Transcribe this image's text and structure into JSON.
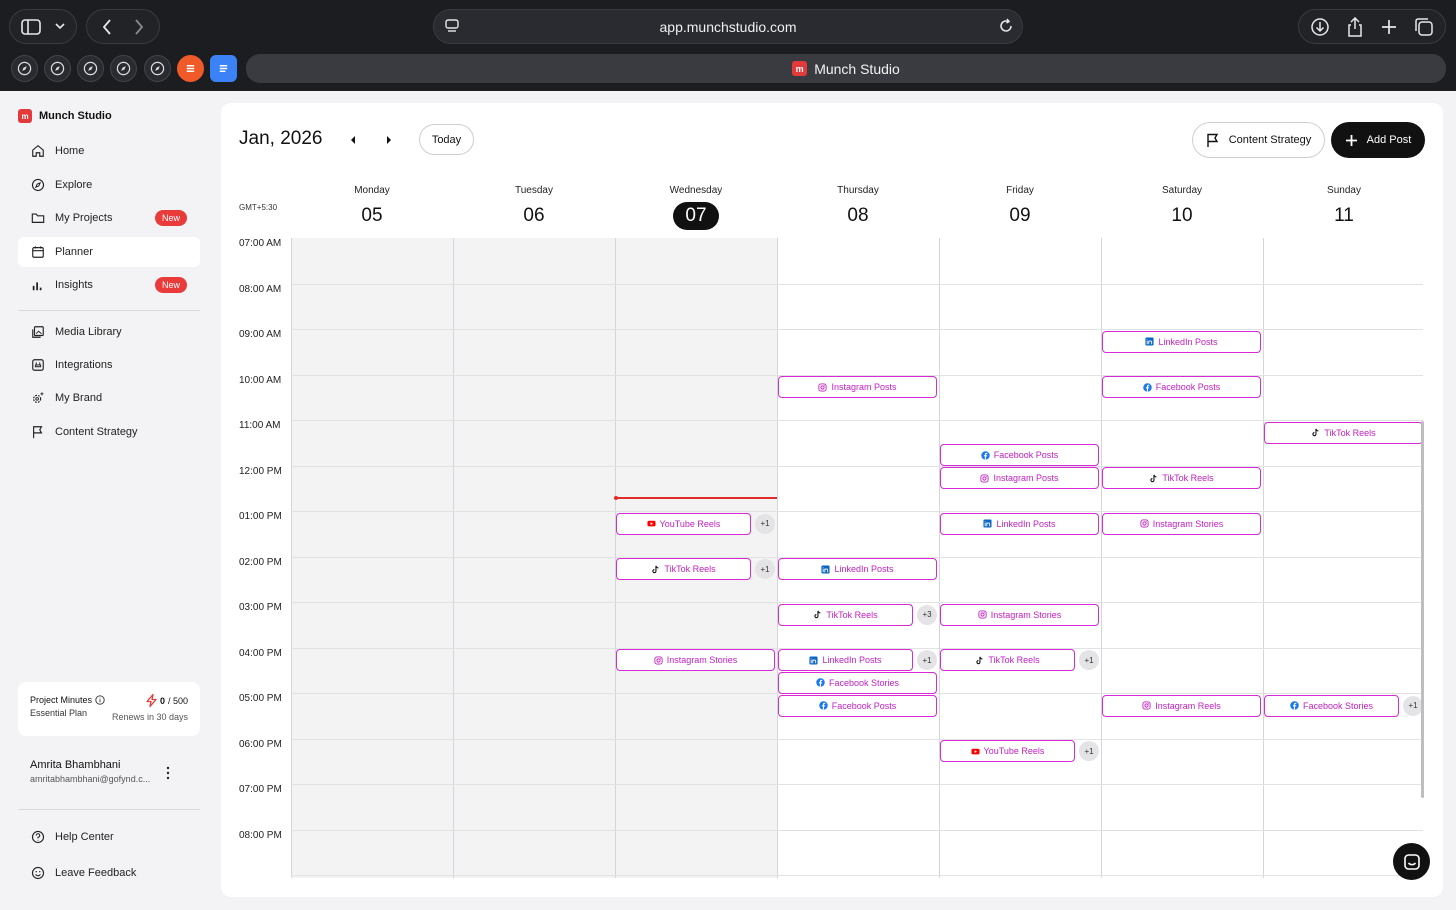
{
  "browser": {
    "url": "app.munchstudio.com",
    "tab_title": "Munch Studio"
  },
  "sidebar": {
    "brand": "Munch Studio",
    "items": [
      {
        "label": "Home",
        "icon": "home-icon"
      },
      {
        "label": "Explore",
        "icon": "compass-icon"
      },
      {
        "label": "My Projects",
        "icon": "folder-icon",
        "badge": "New"
      },
      {
        "label": "Planner",
        "icon": "calendar-icon",
        "active": true
      },
      {
        "label": "Insights",
        "icon": "bar-chart-icon",
        "badge": "New"
      },
      {
        "label": "Media Library",
        "icon": "media-icon"
      },
      {
        "label": "Integrations",
        "icon": "plug-icon"
      },
      {
        "label": "My Brand",
        "icon": "gear-sparkle-icon"
      },
      {
        "label": "Content Strategy",
        "icon": "flag-icon"
      }
    ],
    "minutes": {
      "title": "Project Minutes",
      "plan": "Essential Plan",
      "used": "0",
      "total": "/ 500",
      "renew": "Renews in 30 days"
    },
    "user": {
      "name": "Amrita Bhambhani",
      "email": "amritabhambhani@gofynd.c..."
    },
    "footer": [
      {
        "label": "Help Center",
        "icon": "help-icon"
      },
      {
        "label": "Leave Feedback",
        "icon": "smile-icon"
      }
    ]
  },
  "planner": {
    "month_label": "Jan, 2026",
    "today_label": "Today",
    "content_strategy_label": "Content Strategy",
    "add_post_label": "Add Post",
    "timezone": "GMT+5:30",
    "days": [
      {
        "name": "Monday",
        "num": "05"
      },
      {
        "name": "Tuesday",
        "num": "06"
      },
      {
        "name": "Wednesday",
        "num": "07",
        "current": true
      },
      {
        "name": "Thursday",
        "num": "08"
      },
      {
        "name": "Friday",
        "num": "09"
      },
      {
        "name": "Saturday",
        "num": "10"
      },
      {
        "name": "Sunday",
        "num": "11"
      }
    ],
    "time_labels": [
      "07:00 AM",
      "08:00 AM",
      "09:00 AM",
      "10:00 AM",
      "11:00 AM",
      "12:00 PM",
      "01:00 PM",
      "02:00 PM",
      "03:00 PM",
      "04:00 PM",
      "05:00 PM",
      "06:00 PM",
      "07:00 PM",
      "08:00 PM"
    ],
    "current_time_hour": 12.7,
    "events": [
      {
        "day": 2,
        "hour": 13,
        "label": "YouTube Reels",
        "icon": "youtube",
        "more": "+1"
      },
      {
        "day": 2,
        "hour": 14,
        "label": "TikTok Reels",
        "icon": "tiktok",
        "more": "+1"
      },
      {
        "day": 2,
        "hour": 16,
        "label": "Instagram Stories",
        "icon": "instagram"
      },
      {
        "day": 3,
        "hour": 10,
        "label": "Instagram Posts",
        "icon": "instagram"
      },
      {
        "day": 3,
        "hour": 14,
        "label": "LinkedIn Posts",
        "icon": "linkedin"
      },
      {
        "day": 3,
        "hour": 15,
        "label": "TikTok Reels",
        "icon": "tiktok",
        "more": "+3"
      },
      {
        "day": 3,
        "hour": 16,
        "label": "LinkedIn Posts",
        "icon": "linkedin",
        "more": "+1"
      },
      {
        "day": 3,
        "hour": 16.5,
        "label": "Facebook Stories",
        "icon": "facebook"
      },
      {
        "day": 3,
        "hour": 17,
        "label": "Facebook Posts",
        "icon": "facebook"
      },
      {
        "day": 4,
        "hour": 11.5,
        "label": "Facebook Posts",
        "icon": "facebook"
      },
      {
        "day": 4,
        "hour": 12,
        "label": "Instagram Posts",
        "icon": "instagram"
      },
      {
        "day": 4,
        "hour": 13,
        "label": "LinkedIn Posts",
        "icon": "linkedin"
      },
      {
        "day": 4,
        "hour": 15,
        "label": "Instagram Stories",
        "icon": "instagram"
      },
      {
        "day": 4,
        "hour": 16,
        "label": "TikTok Reels",
        "icon": "tiktok",
        "more": "+1"
      },
      {
        "day": 4,
        "hour": 18,
        "label": "YouTube Reels",
        "icon": "youtube",
        "more": "+1"
      },
      {
        "day": 5,
        "hour": 9,
        "label": "LinkedIn Posts",
        "icon": "linkedin"
      },
      {
        "day": 5,
        "hour": 10,
        "label": "Facebook Posts",
        "icon": "facebook"
      },
      {
        "day": 5,
        "hour": 12,
        "label": "TikTok Reels",
        "icon": "tiktok"
      },
      {
        "day": 5,
        "hour": 13,
        "label": "Instagram Stories",
        "icon": "instagram"
      },
      {
        "day": 5,
        "hour": 17,
        "label": "Instagram Reels",
        "icon": "instagram"
      },
      {
        "day": 6,
        "hour": 11,
        "label": "TikTok Reels",
        "icon": "tiktok"
      },
      {
        "day": 6,
        "hour": 17,
        "label": "Facebook Stories",
        "icon": "facebook",
        "more": "+1"
      }
    ]
  },
  "colors": {
    "event_border": "#d62bd6",
    "event_text": "#c21fc2",
    "brand_red": "#e23a3a",
    "now_line": "#e02b2b"
  }
}
